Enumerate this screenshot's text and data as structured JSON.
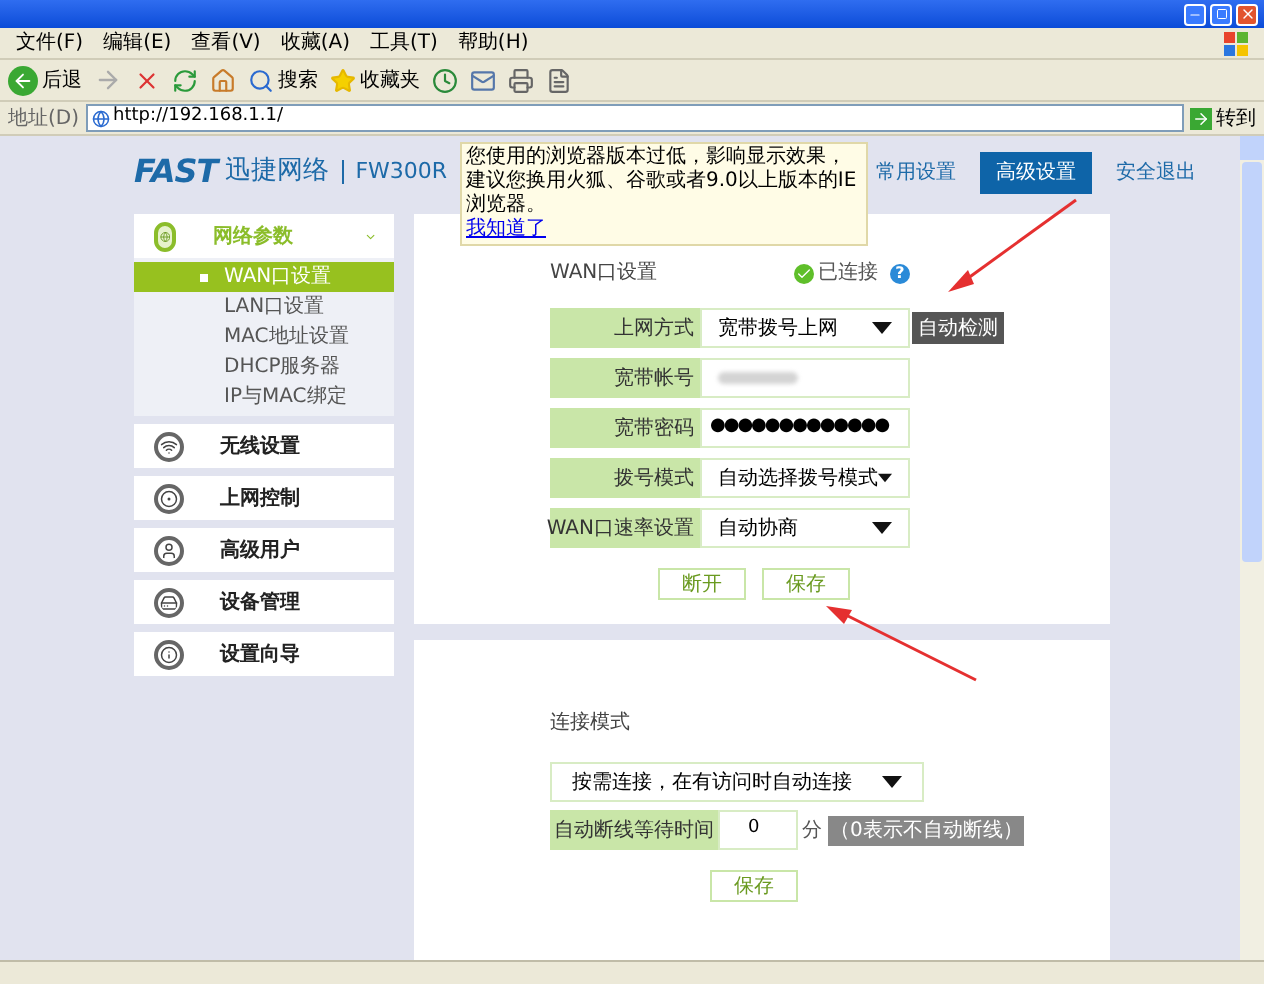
{
  "menu": [
    "文件(F)",
    "编辑(E)",
    "查看(V)",
    "收藏(A)",
    "工具(T)",
    "帮助(H)"
  ],
  "toolbar": {
    "back": "后退",
    "search": "搜索",
    "favorites": "收藏夹"
  },
  "address": {
    "label": "地址(D)",
    "url": "http://192.168.1.1/",
    "go": "转到"
  },
  "header": {
    "brand": "FAST",
    "brand_cn": "迅捷网络",
    "model": "FW300R",
    "nav": [
      {
        "label": "常用设置",
        "selected": false
      },
      {
        "label": "高级设置",
        "selected": true
      },
      {
        "label": "安全退出",
        "selected": false
      }
    ]
  },
  "notice": {
    "text": "您使用的浏览器版本过低，影响显示效果，建议您换用火狐、谷歌或者9.0以上版本的IE浏览器。",
    "link": "我知道了"
  },
  "sidebar": {
    "items": [
      {
        "label": "网络参数",
        "children": [
          {
            "label": "WAN口设置",
            "selected": true
          },
          {
            "label": "LAN口设置",
            "selected": false
          },
          {
            "label": "MAC地址设置",
            "selected": false
          },
          {
            "label": "DHCP服务器",
            "selected": false
          },
          {
            "label": "IP与MAC绑定",
            "selected": false
          }
        ]
      },
      {
        "label": "无线设置"
      },
      {
        "label": "上网控制"
      },
      {
        "label": "高级用户"
      },
      {
        "label": "设备管理"
      },
      {
        "label": "设置向导"
      }
    ]
  },
  "wan": {
    "title": "WAN口设置",
    "status": "已连接",
    "help": "?",
    "fields": [
      {
        "label": "上网方式",
        "kind": "select",
        "value": "宽带拨号上网",
        "action": "自动检测"
      },
      {
        "label": "宽带帐号",
        "kind": "masked"
      },
      {
        "label": "宽带密码",
        "kind": "password",
        "value": "●●●●●●●●●●●●●"
      },
      {
        "label": "拨号模式",
        "kind": "select",
        "value": "自动选择拨号模式"
      },
      {
        "label": "WAN口速率设置",
        "kind": "select",
        "value": "自动协商"
      }
    ],
    "buttons": [
      "断开",
      "保存"
    ]
  },
  "connection": {
    "title": "连接模式",
    "mode": "按需连接，在有访问时自动连接",
    "timeout_label": "自动断线等待时间",
    "timeout_value": "0",
    "unit": "分",
    "hint": "（0表示不自动断线）",
    "button": "保存"
  }
}
